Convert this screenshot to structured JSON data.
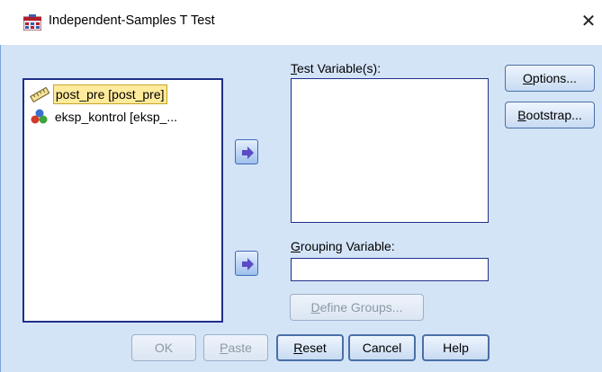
{
  "window": {
    "title": "Independent-Samples T Test",
    "close_glyph": "✕"
  },
  "variables": [
    {
      "label": "post_pre [post_pre]",
      "icon": "scale-ruler-icon",
      "selected": true
    },
    {
      "label": "eksp_kontrol [eksp_...",
      "icon": "nominal-circles-icon",
      "selected": false
    }
  ],
  "test_variables": {
    "label_mnemonic": "T",
    "label_rest": "est Variable(s):"
  },
  "grouping_variable": {
    "label_mnemonic": "G",
    "label_rest": "rouping Variable:",
    "value": ""
  },
  "define_groups": {
    "mnemonic": "D",
    "rest": "efine Groups..."
  },
  "side_buttons": {
    "options": {
      "mnemonic": "O",
      "rest": "ptions..."
    },
    "bootstrap": {
      "mnemonic": "B",
      "rest": "ootstrap..."
    }
  },
  "bottom_buttons": {
    "ok": "OK",
    "paste": {
      "mnemonic": "P",
      "rest": "aste"
    },
    "reset": {
      "mnemonic": "R",
      "rest": "eset"
    },
    "cancel": "Cancel",
    "help": "Help"
  },
  "colors": {
    "dialog_background": "#d4e4f7",
    "list_border": "#1f2f8a",
    "selection_highlight": "#ffeb9c",
    "arrow_icon": "#5b4cc4"
  }
}
